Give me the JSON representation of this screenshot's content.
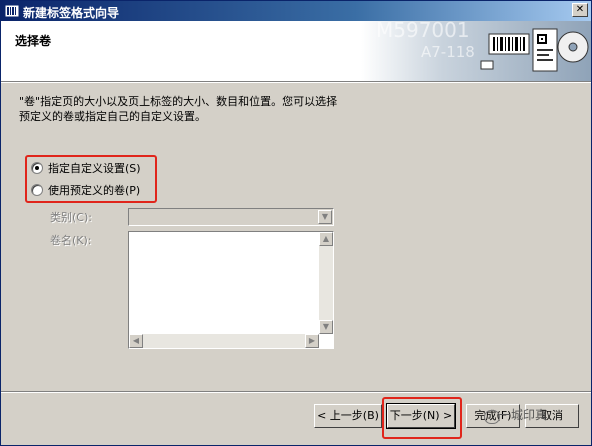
{
  "window": {
    "title": "新建标签格式向导",
    "close_glyph": "✕"
  },
  "header": {
    "title": "选择卷",
    "art_text_1": "M597001",
    "art_text_2": "A7-118",
    "icons": [
      "barcode-label-icon",
      "qr-card-icon",
      "disc-icon"
    ]
  },
  "description": "\"卷\"指定页的大小以及页上标签的大小、数目和位置。您可以选择预定义的卷或指定自己的自定义设置。",
  "options": [
    {
      "label": "指定自定义设置(S)",
      "selected": true
    },
    {
      "label": "使用预定义的卷(P)",
      "selected": false
    }
  ],
  "fields": {
    "category_label": "类别(C):",
    "category_value": "",
    "roll_name_label": "卷名(K):",
    "roll_names": []
  },
  "buttons": {
    "back": "< 上一步(B)",
    "next": "下一步(N) >",
    "finish": "完成(F)",
    "cancel": "取消"
  },
  "watermark": "一城印真",
  "colors": {
    "titlebar": "#0a246a",
    "highlight": "#e0251b",
    "face": "#d4d0c8"
  }
}
